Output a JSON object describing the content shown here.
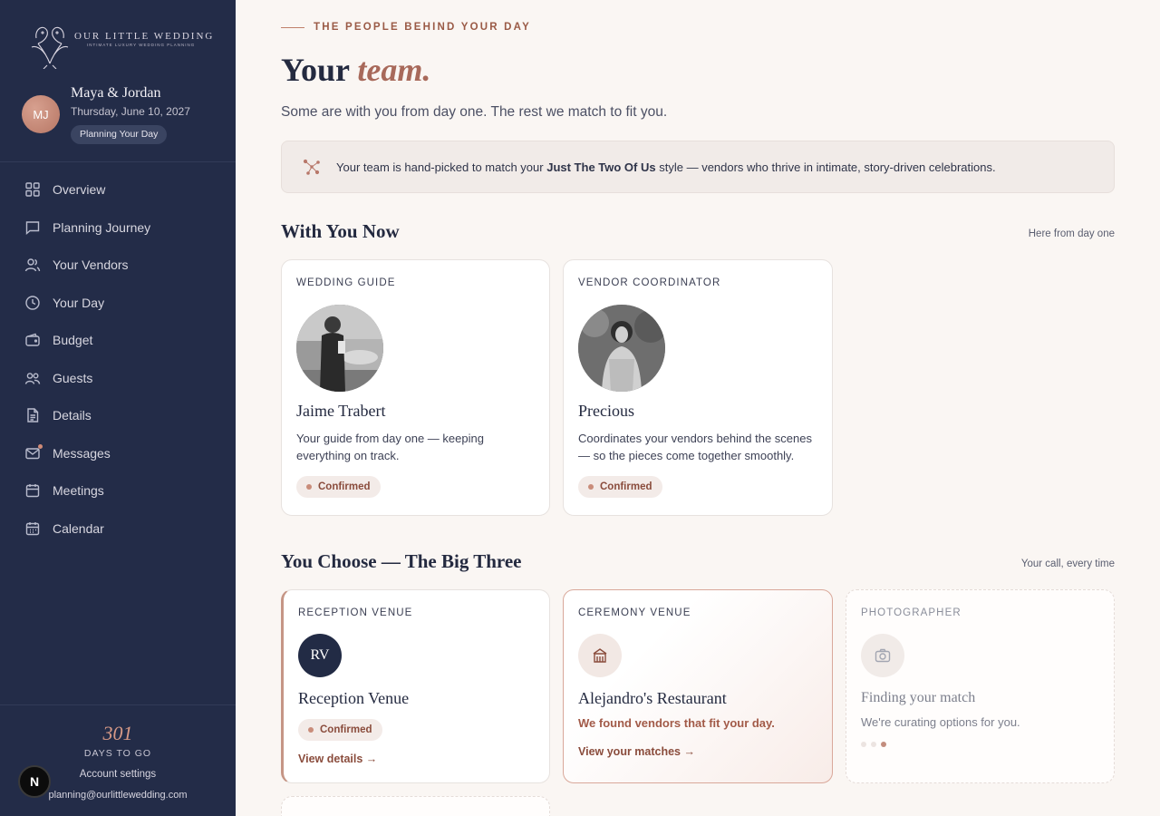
{
  "brand": {
    "name": "OUR LITTLE WEDDING",
    "tagline": "INTIMATE LUXURY WEDDING PLANNING"
  },
  "profile": {
    "initials": "MJ",
    "couple": "Maya & Jordan",
    "date": "Thursday, June 10, 2027",
    "phase": "Planning Your Day"
  },
  "nav": [
    {
      "label": "Overview",
      "icon": "grid-icon"
    },
    {
      "label": "Planning Journey",
      "icon": "chat-icon"
    },
    {
      "label": "Your Vendors",
      "icon": "users-icon"
    },
    {
      "label": "Your Day",
      "icon": "clock-icon"
    },
    {
      "label": "Budget",
      "icon": "wallet-icon"
    },
    {
      "label": "Guests",
      "icon": "guests-icon"
    },
    {
      "label": "Details",
      "icon": "document-icon"
    },
    {
      "label": "Messages",
      "icon": "mail-icon"
    },
    {
      "label": "Meetings",
      "icon": "calendar-icon"
    },
    {
      "label": "Calendar",
      "icon": "calendar-icon"
    }
  ],
  "footer": {
    "days": "301",
    "days_label": "DAYS TO GO",
    "account": "Account settings",
    "email": "planning@ourlittlewedding.com",
    "n_button": "N"
  },
  "header": {
    "eyebrow": "THE PEOPLE BEHIND YOUR DAY",
    "title_plain": "Your",
    "title_italic": "team.",
    "lead": "Some are with you from day one. The rest we match to fit you."
  },
  "banner": {
    "pre": "Your team is hand-picked to match your",
    "bold": "Just The Two Of Us",
    "post": "style — vendors who thrive in intimate, story-driven celebrations."
  },
  "with_you": {
    "title": "With You Now",
    "note": "Here from day one",
    "cards": [
      {
        "role": "WEDDING GUIDE",
        "name": "Jaime Trabert",
        "desc": "Your guide from day one — keeping everything on track.",
        "status": "Confirmed"
      },
      {
        "role": "VENDOR COORDINATOR",
        "name": "Precious",
        "desc": "Coordinates your vendors behind the scenes — so the pieces come together smoothly.",
        "status": "Confirmed"
      }
    ]
  },
  "big_three": {
    "title": "You Choose — The Big Three",
    "note": "Your call, every time",
    "reception": {
      "role": "RECEPTION VENUE",
      "monogram": "RV",
      "name": "Reception Venue",
      "status": "Confirmed",
      "link": "View details →"
    },
    "ceremony": {
      "role": "CEREMONY VENUE",
      "name": "Alejandro's Restaurant",
      "found": "We found vendors that fit your day.",
      "link": "View your matches →"
    },
    "photographer": {
      "role": "PHOTOGRAPHER",
      "name": "Finding your match",
      "desc": "We're curating options for you."
    }
  },
  "colors": {
    "sidebar": "#232c48",
    "accent": "#a8695a",
    "background": "#faf6f3"
  }
}
